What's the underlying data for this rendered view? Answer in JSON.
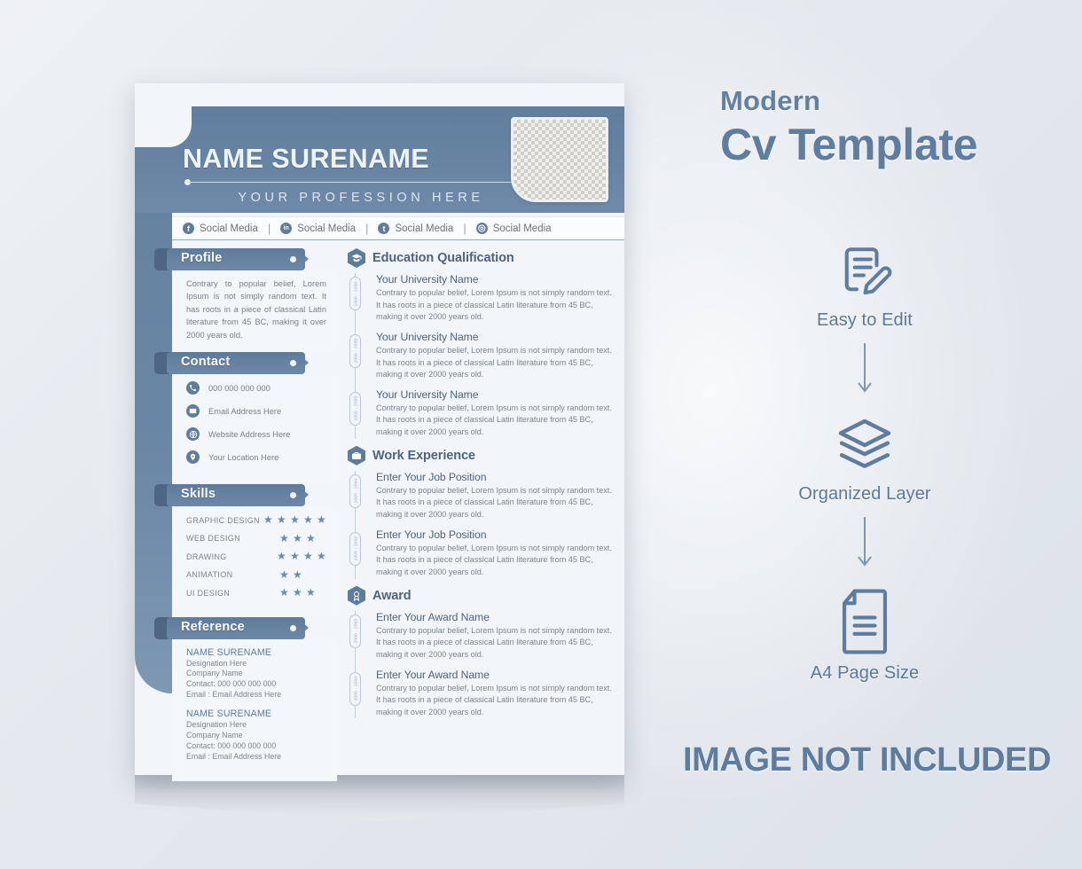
{
  "promo": {
    "subtitle": "Modern",
    "title": "Cv Template",
    "not_included": "IMAGE NOT INCLUDED",
    "features": [
      {
        "icon": "document-edit-icon",
        "label": "Easy to Edit"
      },
      {
        "icon": "layers-icon",
        "label": "Organized Layer"
      },
      {
        "icon": "page-icon",
        "label": "A4 Page Size"
      }
    ]
  },
  "cv": {
    "name": "NAME SURENAME",
    "profession": "YOUR PROFESSION HERE",
    "photo_placeholder": "photo-placeholder",
    "social": [
      {
        "icon": "facebook-icon",
        "glyph": "f",
        "label": "Social Media"
      },
      {
        "icon": "linkedin-icon",
        "glyph": "in",
        "label": "Social Media"
      },
      {
        "icon": "twitter-icon",
        "glyph": "t",
        "label": "Social Media"
      },
      {
        "icon": "instagram-icon",
        "glyph": "◎",
        "label": "Social Media"
      }
    ],
    "separator": "|",
    "profile": {
      "heading": "Profile",
      "text": "Contrary to popular belief, Lorem Ipsum is not simply random text. It has roots in a piece of classical Latin literature from 45 BC, making it over 2000 years old."
    },
    "contact": {
      "heading": "Contact",
      "items": [
        {
          "icon": "phone-icon",
          "text": "000 000 000 000"
        },
        {
          "icon": "email-icon",
          "text": "Email Address Here"
        },
        {
          "icon": "globe-icon",
          "text": "Website Address Here"
        },
        {
          "icon": "location-pin-icon",
          "text": "Your Location Here"
        }
      ]
    },
    "skills": {
      "heading": "Skills",
      "max_stars": 5,
      "items": [
        {
          "name": "GRAPHIC DESIGN",
          "stars": 5
        },
        {
          "name": "WEB DESIGN",
          "stars": 3
        },
        {
          "name": "DRAWING",
          "stars": 4
        },
        {
          "name": "ANIMATION",
          "stars": 2
        },
        {
          "name": "UI DESIGN",
          "stars": 3
        }
      ]
    },
    "reference": {
      "heading": "Reference",
      "items": [
        {
          "name": "NAME SURENAME",
          "designation": "Designation Here",
          "company": "Company Name",
          "contact": "Contact: 000 000 000 000",
          "email": "Email    : Email Address Here"
        },
        {
          "name": "NAME SURENAME",
          "designation": "Designation Here",
          "company": "Company Name",
          "contact": "Contact: 000 000 000 000",
          "email": "Email    : Email Address Here"
        }
      ]
    },
    "education": {
      "icon": "graduation-cap-icon",
      "heading": "Education Qualification",
      "items": [
        {
          "title": "Your University Name",
          "date": "2000 - 2000",
          "desc": "Contrary to popular belief, Lorem Ipsum is not simply random text. It has roots in a piece of classical Latin literature from 45 BC, making it over 2000 years old."
        },
        {
          "title": "Your University Name",
          "date": "2000 - 2000",
          "desc": "Contrary to popular belief, Lorem Ipsum is not simply random text. It has roots in a piece of classical Latin literature from 45 BC, making it over 2000 years old."
        },
        {
          "title": "Your University Name",
          "date": "2000 - 2000",
          "desc": "Contrary to popular belief, Lorem Ipsum is not simply random text. It has roots in a piece of classical Latin literature from 45 BC, making it over 2000 years old."
        }
      ]
    },
    "experience": {
      "icon": "briefcase-icon",
      "heading": "Work Experience",
      "items": [
        {
          "title": "Enter Your Job Position",
          "date": "2000 - 2000",
          "desc": "Contrary to popular belief, Lorem Ipsum is not simply random text. It has roots in a piece of classical Latin literature from 45 BC, making it over 2000 years old."
        },
        {
          "title": "Enter Your Job Position",
          "date": "2000 - 2000",
          "desc": "Contrary to popular belief, Lorem Ipsum is not simply random text. It has roots in a piece of classical Latin literature from 45 BC, making it over 2000 years old."
        }
      ]
    },
    "award": {
      "icon": "award-ribbon-icon",
      "heading": "Award",
      "items": [
        {
          "title": "Enter Your Award Name",
          "date": "2000 - 2000",
          "desc": "Contrary to popular belief, Lorem Ipsum is not simply random text. It has roots in a piece of classical Latin literature from 45 BC, making it over 2000 years old."
        },
        {
          "title": "Enter Your Award Name",
          "date": "2000 - 2000",
          "desc": "Contrary to popular belief, Lorem Ipsum is not simply random text. It has roots in a piece of classical Latin literature from 45 BC, making it over 2000 years old."
        }
      ]
    }
  },
  "colors": {
    "primary_blue": "#5f7c9c",
    "dark_blue": "#4e6683",
    "title_blue": "#4d637e",
    "body_gray": "#7b848d",
    "page_bg": "#f2f5f9"
  }
}
